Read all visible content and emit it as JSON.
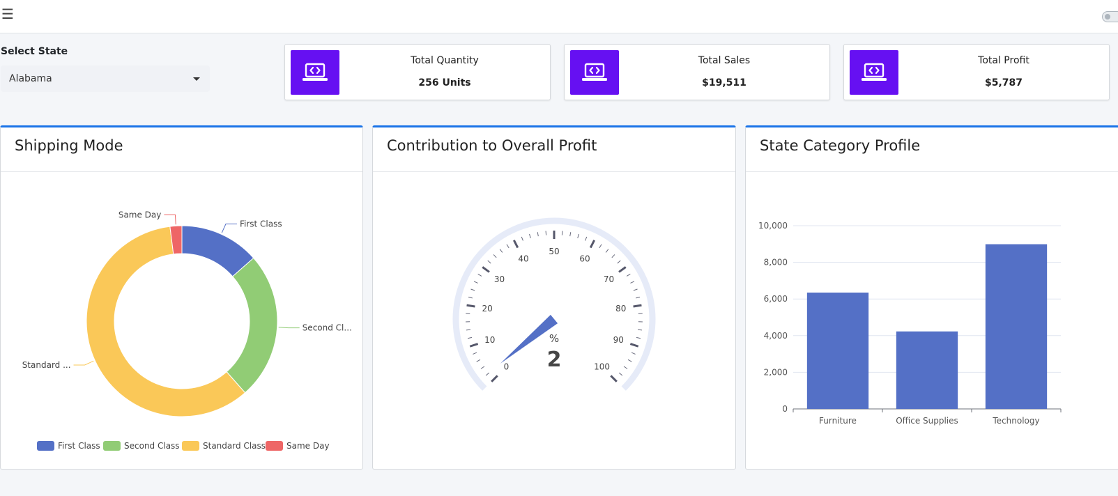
{
  "topbar": {
    "menu_icon": "hamburger-icon",
    "toggle_icon": "toggle-switch"
  },
  "filter": {
    "label": "Select State",
    "selected": "Alabama"
  },
  "kpis": [
    {
      "title": "Total Quantity",
      "value": "256 Units",
      "icon": "laptop-code-icon"
    },
    {
      "title": "Total Sales",
      "value": "$19,511",
      "icon": "laptop-code-icon"
    },
    {
      "title": "Total Profit",
      "value": "$5,787",
      "icon": "laptop-code-icon"
    }
  ],
  "colors": {
    "accent": "#1a73e8",
    "kpi_icon_bg": "#6610f2",
    "first_class": "#5470c6",
    "second_class": "#91cc75",
    "standard_class": "#fac858",
    "same_day": "#ee6666",
    "gauge_track": "#e6ebf8"
  },
  "cards": {
    "shipping": {
      "title": "Shipping Mode"
    },
    "profit": {
      "title": "Contribution to Overall Profit"
    },
    "category": {
      "title": "State Category Profile"
    }
  },
  "chart_data": [
    {
      "type": "pie",
      "subtype": "donut",
      "labels": [
        "First Class",
        "Second Class",
        "Standard Class",
        "Same Day"
      ],
      "label_display": [
        "First Class",
        "Second Cl...",
        "Standard ...",
        "Same Day"
      ],
      "values": [
        13.5,
        25.0,
        59.5,
        2.0
      ],
      "legend": [
        "First Class",
        "Second Class",
        "Standard Class",
        "Same Day"
      ],
      "legend_position": "bottom"
    },
    {
      "type": "gauge",
      "min": 0,
      "max": 100,
      "value": 2,
      "unit": "%",
      "tick_labels": [
        "0",
        "10",
        "20",
        "30",
        "40",
        "50",
        "60",
        "70",
        "80",
        "90",
        "100"
      ]
    },
    {
      "type": "bar",
      "categories": [
        "Furniture",
        "Office Supplies",
        "Technology"
      ],
      "values": [
        6350,
        4230,
        8990
      ],
      "ylim": [
        0,
        10000
      ],
      "yticks": [
        "0",
        "2,000",
        "4,000",
        "6,000",
        "8,000",
        "10,000"
      ],
      "grid": true
    }
  ]
}
